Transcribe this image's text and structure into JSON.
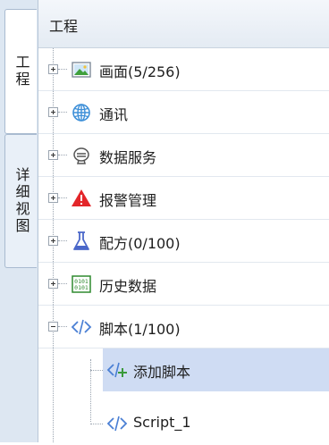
{
  "tabs": [
    {
      "label": "工程",
      "active": true
    },
    {
      "label": "详细视图",
      "active": false
    }
  ],
  "panel": {
    "title": "工程"
  },
  "tree": [
    {
      "label": "画面(5/256)",
      "icon": "screen-image-icon"
    },
    {
      "label": "通讯",
      "icon": "globe-icon"
    },
    {
      "label": "数据服务",
      "icon": "database-service-icon"
    },
    {
      "label": "报警管理",
      "icon": "alarm-warning-icon"
    },
    {
      "label": "配方(0/100)",
      "icon": "flask-icon"
    },
    {
      "label": "历史数据",
      "icon": "binary-data-icon"
    },
    {
      "label": "脚本(1/100)",
      "icon": "code-icon",
      "expanded": true,
      "children": [
        {
          "label": "添加脚本",
          "icon": "add-code-icon",
          "selected": true
        },
        {
          "label": "Script_1",
          "icon": "code-icon"
        }
      ]
    }
  ],
  "colors": {
    "selection": "#cfdcf3",
    "alarm": "#e3262a",
    "code": "#4a7fd4",
    "flask": "#4a67c9",
    "binary": "#2f8a2f"
  }
}
